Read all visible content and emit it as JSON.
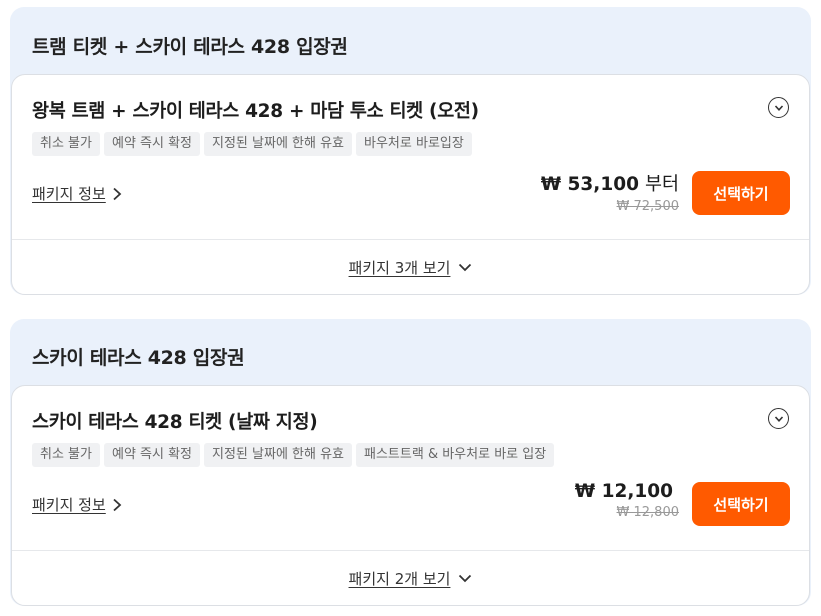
{
  "groups": [
    {
      "title": "트램 티켓 + 스카이 테라스 428 입장권",
      "card": {
        "title": "왕복 트램 + 스카이 테라스 428 + 마담 투소 티켓 (오전)",
        "tags": [
          "취소 불가",
          "예약 즉시 확정",
          "지정된 날짜에 한해 유효",
          "바우처로 바로입장"
        ],
        "package_info_label": "패키지 정보",
        "price": "₩ 53,100",
        "price_suffix": "부터",
        "original_price": "₩ 72,500",
        "select_label": "선택하기",
        "more_label": "패키지 3개 보기"
      }
    },
    {
      "title": "스카이 테라스 428 입장권",
      "card": {
        "title": "스카이 테라스 428 티켓 (날짜 지정)",
        "tags": [
          "취소 불가",
          "예약 즉시 확정",
          "지정된 날짜에 한해 유효",
          "패스트트랙 & 바우처로 바로 입장"
        ],
        "package_info_label": "패키지 정보",
        "price": "₩ 12,100",
        "price_suffix": "",
        "original_price": "₩ 12,800",
        "select_label": "선택하기",
        "more_label": "패키지 2개 보기"
      }
    }
  ],
  "colors": {
    "accent": "#ff5a00",
    "group_bg": "#eaf1fb",
    "tag_bg": "#f0f1f3"
  },
  "icons": [
    "chevron-down-circle-icon",
    "chevron-right-icon",
    "chevron-down-icon"
  ]
}
